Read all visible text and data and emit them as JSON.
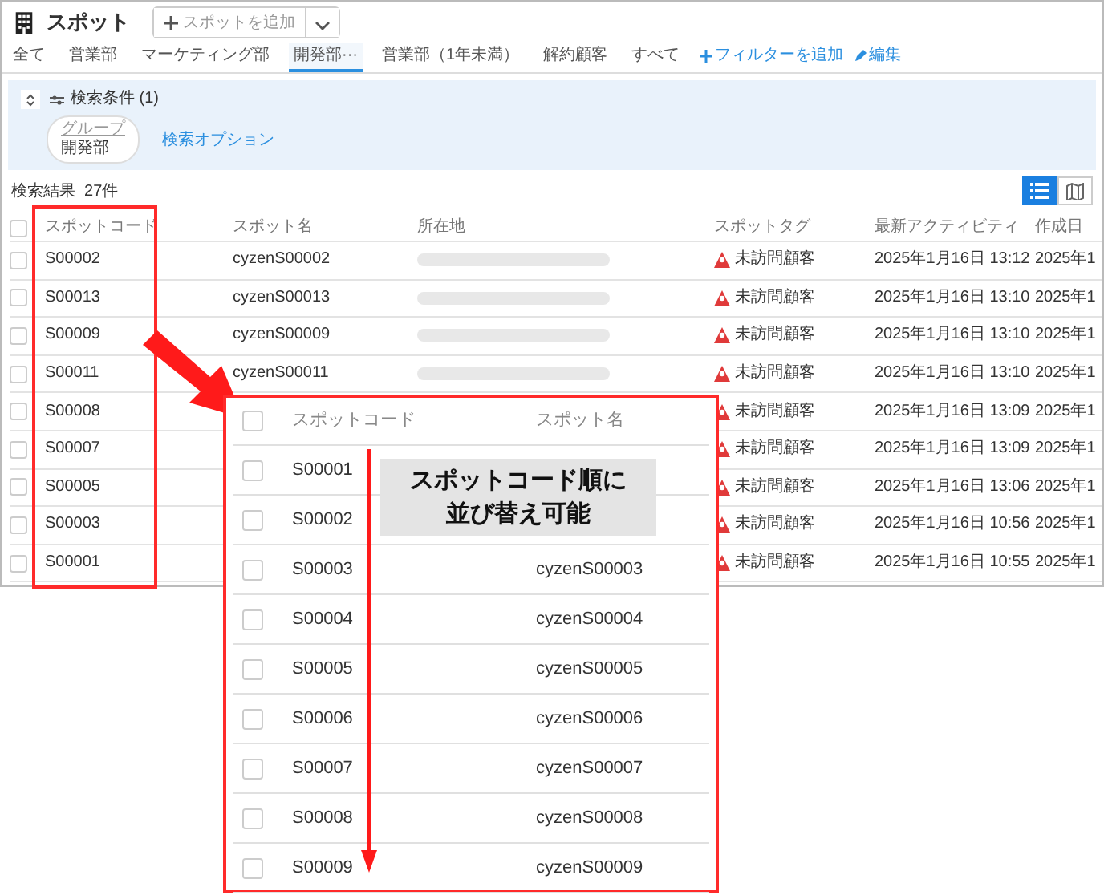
{
  "header": {
    "title": "スポット",
    "add_button": "スポットを追加"
  },
  "tabs": [
    {
      "label": "全て",
      "selected": false
    },
    {
      "label": "営業部",
      "selected": false
    },
    {
      "label": "マーケティング部",
      "selected": false
    },
    {
      "label": "開発部",
      "selected": true,
      "menu": "···"
    },
    {
      "label": "営業部（1年未満）",
      "selected": false
    },
    {
      "label": "解約顧客",
      "selected": false
    },
    {
      "label": "すべて",
      "selected": false
    }
  ],
  "add_filter": "フィルターを追加",
  "edit": "編集",
  "search_panel": {
    "conditions": "検索条件 (1)",
    "chip_label": "グループ",
    "chip_value": "開発部",
    "options_link": "検索オプション"
  },
  "results": {
    "label": "検索結果",
    "count": "27件",
    "views": [
      {
        "kind": "list",
        "selected": true
      },
      {
        "kind": "map",
        "selected": false
      }
    ]
  },
  "table": {
    "select_all_checked": false,
    "columns": [
      "スポットコード",
      "スポット名",
      "所在地",
      "スポットタグ",
      "最新アクティビティ",
      "作成日"
    ],
    "rows": [
      {
        "checked": false,
        "code": "S00002",
        "name": "cyzenS00002",
        "tag": "未訪問顧客",
        "activity": "2025年1月16日 13:12",
        "created": "2025年1"
      },
      {
        "checked": false,
        "code": "S00013",
        "name": "cyzenS00013",
        "tag": "未訪問顧客",
        "activity": "2025年1月16日 13:10",
        "created": "2025年1"
      },
      {
        "checked": false,
        "code": "S00009",
        "name": "cyzenS00009",
        "tag": "未訪問顧客",
        "activity": "2025年1月16日 13:10",
        "created": "2025年1"
      },
      {
        "checked": false,
        "code": "S00011",
        "name": "cyzenS00011",
        "tag": "未訪問顧客",
        "activity": "2025年1月16日 13:10",
        "created": "2025年1"
      },
      {
        "checked": false,
        "code": "S00008",
        "tag": "未訪問顧客",
        "activity": "2025年1月16日 13:09",
        "created": "2025年1"
      },
      {
        "checked": false,
        "code": "S00007",
        "tag": "未訪問顧客",
        "activity": "2025年1月16日 13:09",
        "created": "2025年1"
      },
      {
        "checked": false,
        "code": "S00005",
        "tag": "未訪問顧客",
        "activity": "2025年1月16日 13:06",
        "created": "2025年1"
      },
      {
        "checked": false,
        "code": "S00003",
        "tag": "未訪問顧客",
        "activity": "2025年1月16日 10:56",
        "created": "2025年1"
      },
      {
        "checked": false,
        "code": "S00001",
        "tag": "未訪問顧客",
        "activity": "2025年1月16日 10:55",
        "created": "2025年1"
      }
    ]
  },
  "zoom_panel": {
    "select_all_checked": false,
    "columns": [
      "スポットコード",
      "スポット名"
    ],
    "rows": [
      {
        "checked": false,
        "code": "S00001"
      },
      {
        "checked": false,
        "code": "S00002"
      },
      {
        "checked": false,
        "code": "S00003",
        "name": "cyzenS00003"
      },
      {
        "checked": false,
        "code": "S00004",
        "name": "cyzenS00004"
      },
      {
        "checked": false,
        "code": "S00005",
        "name": "cyzenS00005"
      },
      {
        "checked": false,
        "code": "S00006",
        "name": "cyzenS00006"
      },
      {
        "checked": false,
        "code": "S00007",
        "name": "cyzenS00007"
      },
      {
        "checked": false,
        "code": "S00008",
        "name": "cyzenS00008"
      },
      {
        "checked": false,
        "code": "S00009",
        "name": "cyzenS00009"
      }
    ],
    "callout": [
      "スポットコード順に",
      "並び替え可能"
    ]
  }
}
